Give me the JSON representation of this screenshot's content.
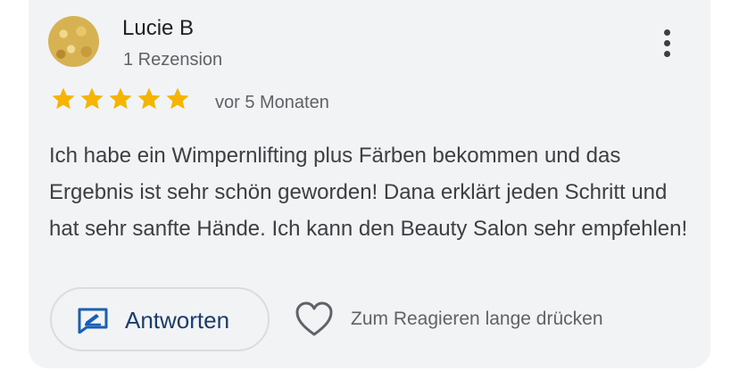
{
  "reviewer": {
    "name": "Lucie B",
    "review_count": "1 Rezension",
    "avatar_icon": "profile-photo"
  },
  "rating": {
    "stars": 5,
    "max": 5,
    "star_color": "#f4b400",
    "date": "vor 5 Monaten"
  },
  "review": {
    "text": "Ich habe ein Wimpernlifting plus Färben bekommen und das Ergebnis ist sehr schön geworden! Dana erklärt jeden Schritt und hat sehr sanfte Hände. Ich kann den Beauty Salon sehr empfehlen!"
  },
  "actions": {
    "reply_label": "Antworten",
    "reply_icon": "reply-edit-icon",
    "react_label": "Zum Reagieren lange drücken",
    "react_icon": "heart-icon",
    "menu_icon": "more-vert-icon"
  },
  "colors": {
    "card_bg": "#f1f3f4",
    "accent": "#1a3c6e"
  }
}
